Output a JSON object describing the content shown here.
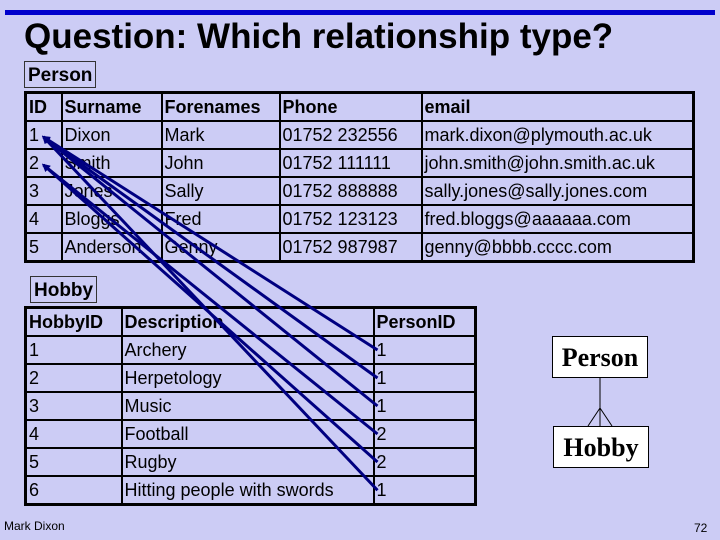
{
  "title": "Question: Which relationship type?",
  "person_table": {
    "name": "Person",
    "columns": [
      "ID",
      "Surname",
      "Forenames",
      "Phone",
      "email"
    ],
    "rows": [
      [
        "1",
        "Dixon",
        "Mark",
        "01752 232556",
        "mark.dixon@plymouth.ac.uk"
      ],
      [
        "2",
        "Smith",
        "John",
        "01752 111111",
        "john.smith@john.smith.ac.uk"
      ],
      [
        "3",
        "Jones",
        "Sally",
        "01752 888888",
        "sally.jones@sally.jones.com"
      ],
      [
        "4",
        "Bloggs",
        "Fred",
        "01752 123123",
        "fred.bloggs@aaaaaa.com"
      ],
      [
        "5",
        "Anderson",
        "Genny",
        "01752 987987",
        "genny@bbbb.cccc.com"
      ]
    ]
  },
  "hobby_table": {
    "name": "Hobby",
    "columns": [
      "HobbyID",
      "Description",
      "PersonID"
    ],
    "rows": [
      [
        "1",
        "Archery",
        "1"
      ],
      [
        "2",
        "Herpetology",
        "1"
      ],
      [
        "3",
        "Music",
        "1"
      ],
      [
        "4",
        "Football",
        "2"
      ],
      [
        "5",
        "Rugby",
        "2"
      ],
      [
        "6",
        "Hitting people with swords",
        "1"
      ]
    ]
  },
  "links": [
    {
      "from_hobby_row": 1,
      "to_person_id": 1
    },
    {
      "from_hobby_row": 2,
      "to_person_id": 1
    },
    {
      "from_hobby_row": 3,
      "to_person_id": 1
    },
    {
      "from_hobby_row": 4,
      "to_person_id": 2
    },
    {
      "from_hobby_row": 5,
      "to_person_id": 2
    },
    {
      "from_hobby_row": 6,
      "to_person_id": 1
    }
  ],
  "er_diagram": {
    "parent": "Person",
    "child": "Hobby",
    "relationship": "one-to-many"
  },
  "colors": {
    "background": "#ccccf5",
    "top_bar": "#0000cc",
    "arrow": "#000080"
  },
  "footer": {
    "author": "Mark Dixon",
    "page_number": "72"
  }
}
